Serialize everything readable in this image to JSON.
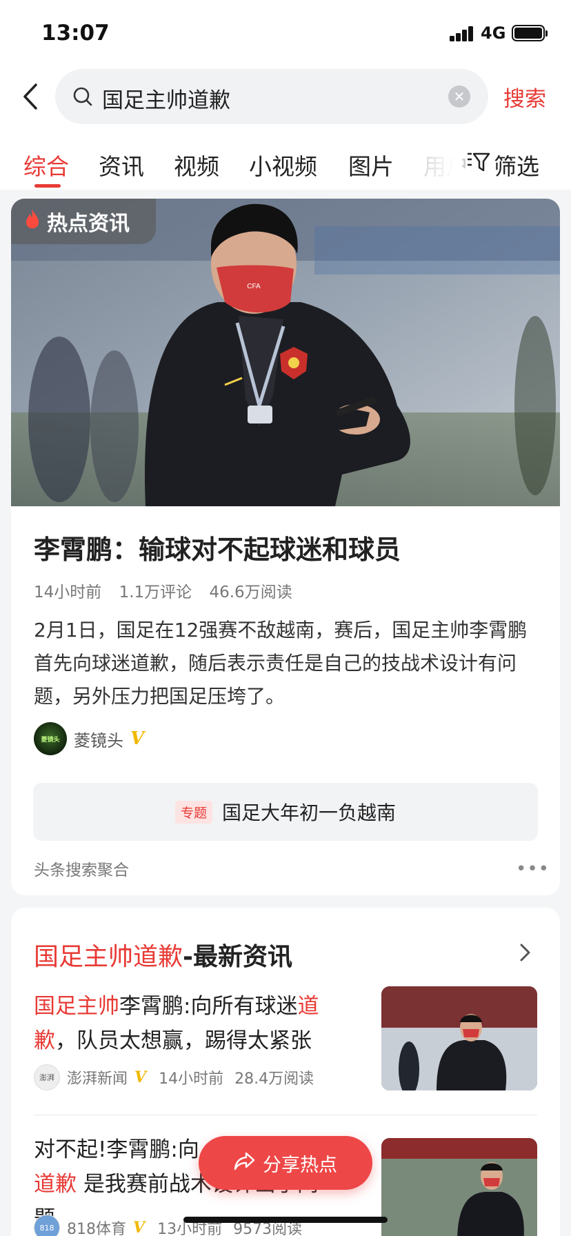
{
  "status": {
    "time": "13:07",
    "network": "4G"
  },
  "search": {
    "query": "国足主帅道歉",
    "button": "搜索",
    "clear": "✕"
  },
  "tabs": [
    "综合",
    "资讯",
    "视频",
    "小视频",
    "图片",
    "用户"
  ],
  "filter_label": "筛选",
  "hot_news": {
    "badge": "热点资讯",
    "title": "李霄鹏：输球对不起球迷和球员",
    "meta": {
      "time": "14小时前",
      "comments": "1.1万评论",
      "reads": "46.6万阅读"
    },
    "description": "2月1日，国足在12强赛不敌越南，赛后，国足主帅李霄鹏首先向球迷道歉，随后表示责任是自己的技战术设计有问题，另外压力把国足压垮了。",
    "source": {
      "name": "菱镜头",
      "avatar_text": "菱镜头"
    },
    "topic": {
      "tag": "专题",
      "title": "国足大年初一负越南"
    },
    "footer": "头条搜索聚合",
    "more": "•••"
  },
  "latest": {
    "heading_highlight": "国足主帅道歉",
    "heading_rest": "-最新资讯",
    "items": [
      {
        "t1": "国足主帅",
        "t2": "李霄鹏:向所有球迷",
        "t3": "道",
        "t4": "歉",
        "t5": "，队员太想赢，踢得太紧张",
        "source": "澎湃新闻",
        "avatar_text": "澎湃",
        "time": "14小时前",
        "reads": "28.4万阅读"
      },
      {
        "t1": "对不起!李霄鹏:向",
        "t2": "",
        "t3": "",
        "t4": "道歉",
        "t5": " 是我赛前战术设计出了问题",
        "source": "818体育",
        "avatar_text": "818",
        "time": "13小时前",
        "reads": "9573阅读"
      }
    ]
  },
  "share_button": "分享热点",
  "colors": {
    "accent": "#e83a35",
    "share": "#ee4747",
    "verified": "#f0b800"
  }
}
